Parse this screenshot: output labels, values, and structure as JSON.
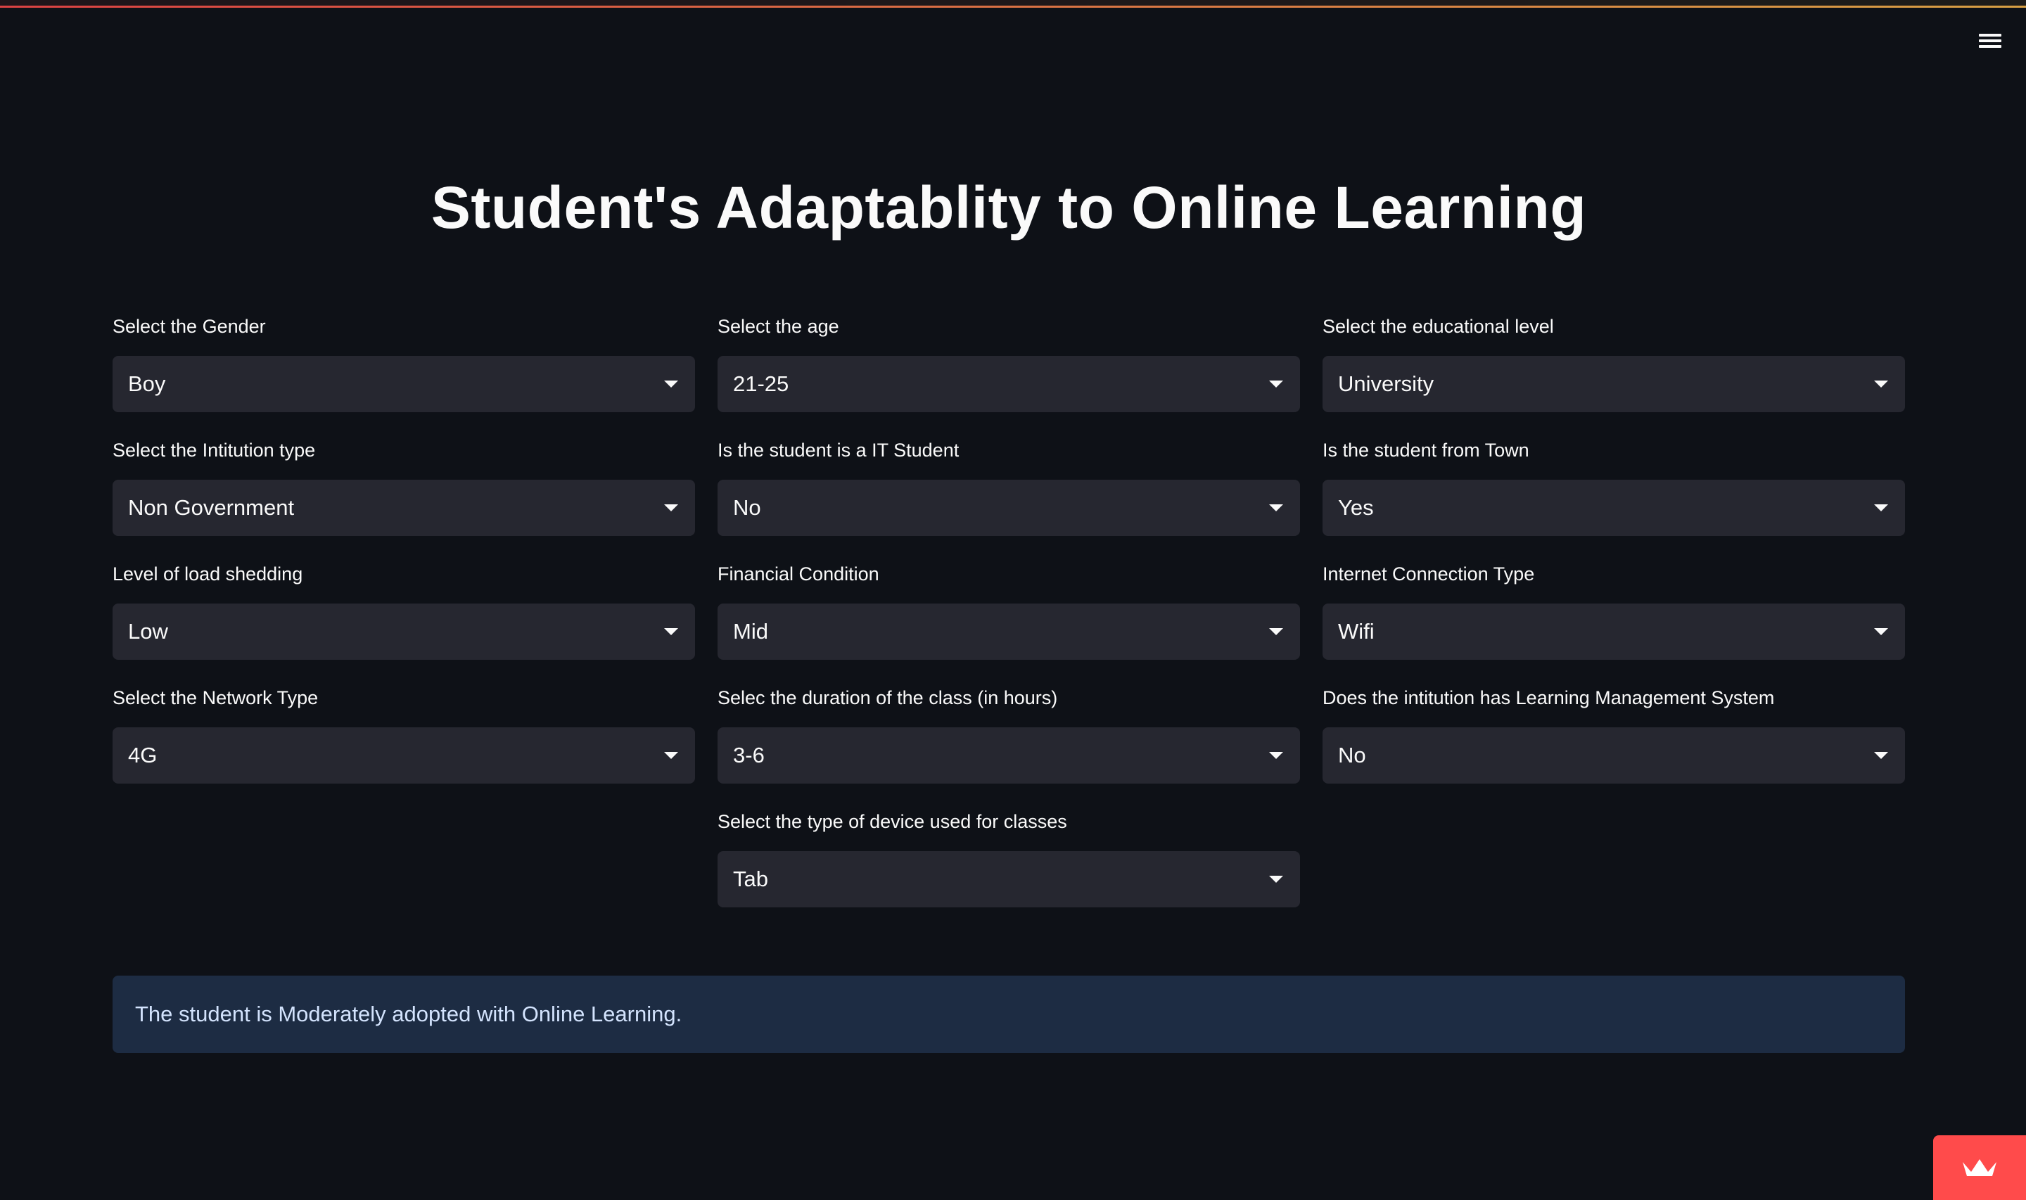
{
  "title": "Student's Adaptablity to Online Learning",
  "menu_icon": "hamburger-menu-icon",
  "fields": [
    {
      "label": "Select the Gender",
      "value": "Boy"
    },
    {
      "label": "Select the age",
      "value": "21-25"
    },
    {
      "label": "Select the educational level",
      "value": "University"
    },
    {
      "label": "Select the Intitution type",
      "value": "Non Government"
    },
    {
      "label": "Is the student is a IT Student",
      "value": "No"
    },
    {
      "label": "Is the student from Town",
      "value": "Yes"
    },
    {
      "label": "Level of load shedding",
      "value": "Low"
    },
    {
      "label": "Financial Condition",
      "value": "Mid"
    },
    {
      "label": "Internet Connection Type",
      "value": "Wifi"
    },
    {
      "label": "Select the Network Type",
      "value": "4G"
    },
    {
      "label": "Selec the duration of the class (in hours)",
      "value": "3-6"
    },
    {
      "label": "Does the intitution has Learning Management System",
      "value": "No"
    },
    {
      "label": "Select the type of device used for classes",
      "value": "Tab"
    }
  ],
  "result": {
    "text": "The student is Moderately adopted with Online Learning."
  },
  "colors": {
    "background": "#0e1117",
    "select_bg": "#262730",
    "info_bg": "#1d2c43",
    "info_text": "#d3e3fd",
    "badge": "#ff4b4b"
  },
  "badge_icon": "streamlit-crown-icon"
}
